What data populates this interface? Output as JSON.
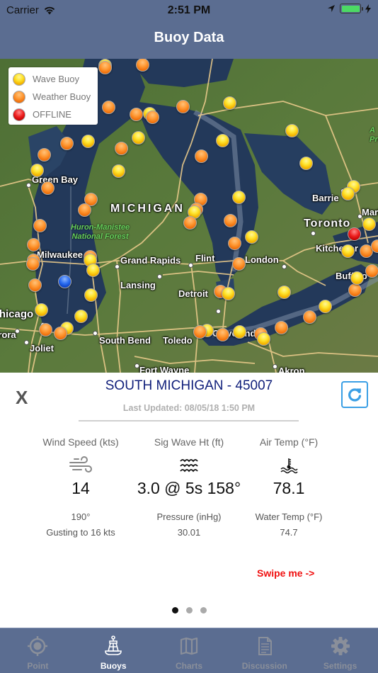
{
  "status_bar": {
    "carrier": "Carrier",
    "time": "2:51 PM"
  },
  "nav": {
    "title": "Buoy Data"
  },
  "map": {
    "legend": [
      {
        "type": "wave",
        "label": "Wave Buoy"
      },
      {
        "type": "weather",
        "label": "Weather Buoy"
      },
      {
        "type": "offline",
        "label": "OFFLINE"
      }
    ],
    "labels": {
      "green_bay": "Green Bay",
      "michigan": "MICHIGAN",
      "park_line1": "Huron-Manistee",
      "park_line2": "National Forest",
      "milwaukee": "Milwaukee",
      "grand_rapids": "Grand Rapids",
      "flint": "Flint",
      "london": "London",
      "lansing": "Lansing",
      "detroit": "Detroit",
      "chicago": "Chicago",
      "aurora": "Aurora",
      "joliet": "Joliet",
      "south_bend": "South Bend",
      "toledo": "Toledo",
      "fort_wayne": "Fort Wayne",
      "akron": "Akron",
      "barrie": "Barrie",
      "toronto": "Toronto",
      "kitchener": "Kitchener",
      "buffalo": "Buffalo",
      "cleveland": "Cleveland",
      "markham": "Markham",
      "park_e1": "A",
      "park_e2": "Pro"
    },
    "colors": {
      "wave": "#ffd21f",
      "weather": "#ff8a1e",
      "offline": "#e01010",
      "selected": "#1f5fe0"
    }
  },
  "panel": {
    "close_label": "X",
    "station": "SOUTH MICHIGAN - 45007",
    "updated": "Last Updated: 08/05/18 1:50 PM",
    "wind": {
      "label": "Wind Speed (kts)",
      "value": "14",
      "direction": "190°",
      "gust": "Gusting to 16 kts"
    },
    "wave": {
      "label": "Sig Wave Ht (ft)",
      "value": "3.0 @ 5s 158°"
    },
    "pressure": {
      "label": "Pressure (inHg)",
      "value": "30.01"
    },
    "air": {
      "label": "Air Temp (°F)",
      "value": "78.1"
    },
    "water": {
      "label": "Water Temp (°F)",
      "value": "74.7"
    },
    "swipe_hint": "Swipe me ->",
    "pages": {
      "total": 3,
      "current": 1
    },
    "accent": "#3a9fe5",
    "station_color": "#0f1e7a",
    "hint_color": "#f01010"
  },
  "tabs": [
    {
      "label": "Point",
      "icon": "crosshair-icon",
      "active": false
    },
    {
      "label": "Buoys",
      "icon": "buoy-icon",
      "active": true
    },
    {
      "label": "Charts",
      "icon": "map-icon",
      "active": false
    },
    {
      "label": "Discussion",
      "icon": "document-icon",
      "active": false
    },
    {
      "label": "Settings",
      "icon": "gear-icon",
      "active": false
    }
  ]
}
